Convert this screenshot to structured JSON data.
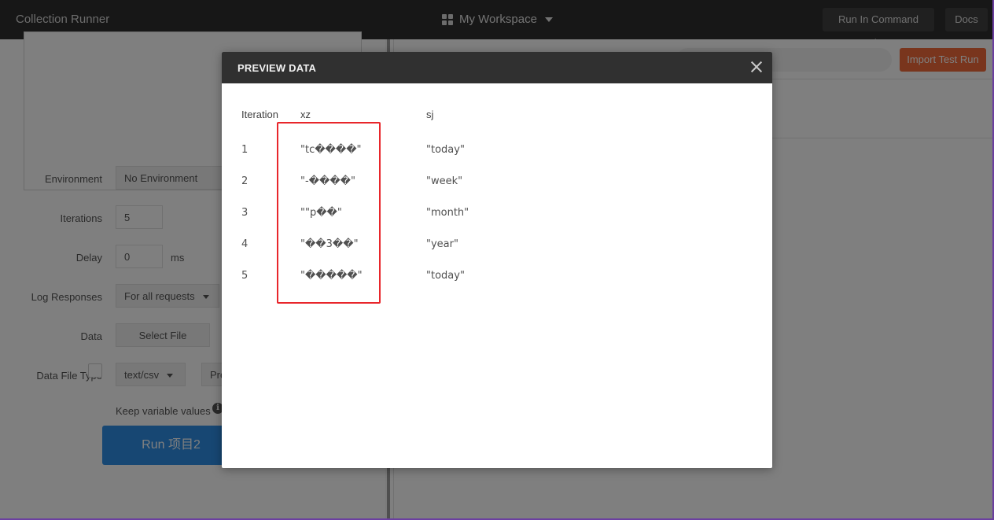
{
  "header": {
    "app_title": "Collection Runner",
    "workspace": "My Workspace",
    "run_cmd_label": "Run In Command Line",
    "docs_label": "Docs"
  },
  "form": {
    "environment_label": "Environment",
    "environment_value": "No Environment",
    "iterations_label": "Iterations",
    "iterations_value": "5",
    "delay_label": "Delay",
    "delay_value": "0",
    "delay_unit": "ms",
    "log_label": "Log Responses",
    "log_value": "For all requests",
    "data_label": "Data",
    "select_file_label": "Select File",
    "data_type_label": "Data File Type",
    "data_type_value": "text/csv",
    "preview_partial": "Pre",
    "keep_vars_label": "Keep variable values",
    "run_label": "Run 项目2"
  },
  "right": {
    "import_label": "Import Test Run"
  },
  "modal": {
    "title": "PREVIEW DATA",
    "columns": [
      "Iteration",
      "xz",
      "sj"
    ],
    "rows": [
      {
        "iteration": "1",
        "xz": "\"tc����\"",
        "sj": "\"today\""
      },
      {
        "iteration": "2",
        "xz": "\"-����\"",
        "sj": "\"week\""
      },
      {
        "iteration": "3",
        "xz": "\"\"p��\"",
        "sj": "\"month\""
      },
      {
        "iteration": "4",
        "xz": "\"��3��\"",
        "sj": "\"year\""
      },
      {
        "iteration": "5",
        "xz": "\"�����\"",
        "sj": "\"today\""
      }
    ]
  }
}
